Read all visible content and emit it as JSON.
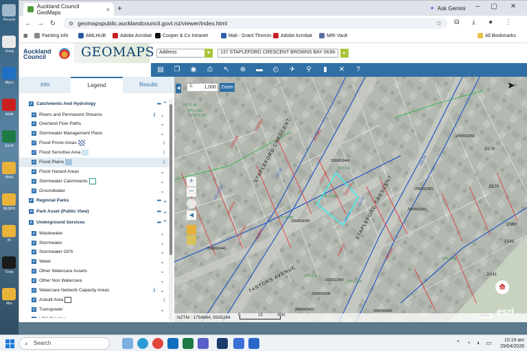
{
  "desktop": {
    "icons": [
      {
        "label": "Recycle",
        "color": "#9fb8cc"
      },
      {
        "label": "Goog",
        "color": "#e8e8e8"
      },
      {
        "label": "Micro",
        "color": "#1f6fc4"
      },
      {
        "label": "Adob",
        "color": "#c82020"
      },
      {
        "label": "Excel",
        "color": "#1d7a43"
      },
      {
        "label": "Work",
        "color": "#e9b23a"
      },
      {
        "label": "RESPO",
        "color": "#e9b23a"
      },
      {
        "label": "BI",
        "color": "#e9b23a"
      },
      {
        "label": "Coop",
        "color": "#1a1a1a"
      },
      {
        "label": "Mrs",
        "color": "#e9b23a"
      }
    ]
  },
  "browser": {
    "tab_title": "Auckland Council GeoMaps",
    "tab_close": "×",
    "new_tab": "+",
    "ask_gemini": "Ask Gemini",
    "url": "geomapspublic.aucklandcouncil.govt.nz/viewer/index.html",
    "bookmarks": [
      {
        "label": "Painting info",
        "color": "#888888"
      },
      {
        "label": "AMLHUB",
        "color": "#2b5aa0"
      },
      {
        "label": "Adobe Acrobat",
        "color": "#c82020"
      },
      {
        "label": "Cooper & Co Intranet",
        "color": "#111111"
      },
      {
        "label": "Mail - Grant Thornin...",
        "color": "#2c5fa8"
      },
      {
        "label": "Adobe Acrobat",
        "color": "#c82020"
      },
      {
        "label": "MRI Vault",
        "color": "#5a6ea0"
      }
    ],
    "all_bookmarks": "All Bookmarks"
  },
  "header": {
    "logo_line1": "Auckland",
    "logo_line2": "Council",
    "app_title": "GEOMAPS",
    "search_type": "Address",
    "search_value": "137 STAPLEFORD CRESCENT BROWNS BAY 0630",
    "clear_icon": "×"
  },
  "panel": {
    "tabs": [
      "Info",
      "Legend",
      "Results"
    ],
    "layers": [
      {
        "label": "Catchments And Hydrology",
        "group": true
      },
      {
        "label": "Rivers and Permanent Streams",
        "info": true
      },
      {
        "label": "Overland Flow Paths"
      },
      {
        "label": "Stormwater Management Plans"
      },
      {
        "label": "Flood Prone Areas",
        "swatch": "hatch"
      },
      {
        "label": "Flood Sensitive Area",
        "swatch": "#cfe6f5"
      },
      {
        "label": "Flood Plains",
        "swatch": "#a6c4e0",
        "highlight": true
      },
      {
        "label": "Flood Hazard Areas"
      },
      {
        "label": "Stormwater Catchments",
        "swatch": "outline-teal"
      },
      {
        "label": "Groundwater"
      },
      {
        "label": "Regional Parks",
        "group": true
      },
      {
        "label": "Park Asset (Public View)",
        "group": true
      },
      {
        "label": "Underground Services",
        "group": true
      },
      {
        "label": "Wastewater"
      },
      {
        "label": "Stormwater"
      },
      {
        "label": "Stormwater GPS"
      },
      {
        "label": "Water"
      },
      {
        "label": "Other Watercare Assets"
      },
      {
        "label": "Other Non Watercare"
      },
      {
        "label": "Watercare Network Capacity Areas",
        "info": true
      },
      {
        "label": "Asbuilt Area",
        "swatch": "outline-dark"
      },
      {
        "label": "Transpower"
      },
      {
        "label": "LPG Pipeline"
      }
    ]
  },
  "map": {
    "scale_prefix": "1:",
    "scale_value": "1,000",
    "zoom_label": "Zoom",
    "coords": "NZTM : 1754884, 5935284",
    "scale_labels": [
      "0",
      "15",
      "30m"
    ],
    "public_label": "public",
    "esri_label": "esri",
    "street_labels": [
      "STAPLEFORD CRESCENT",
      "STAPLEFORD CRESCENT",
      "TARTORS AVENUE"
    ],
    "dti_labels": [
      "DTI 1.49",
      "DTI 1.61",
      "DTI 1.6",
      "DTI 1.05",
      "DTI 1.85",
      "DTI 1.64",
      "DTI 1.06",
      "DTI 1.8",
      "DTI 1.9",
      "DTI 1.74"
    ],
    "asset_ids": [
      "2000663356",
      "2000659440",
      "2000659285",
      "2000112457",
      "2000663441",
      "2000669936",
      "2000663450",
      "2000065585",
      "2000661081",
      "2000661081"
    ],
    "pipe_labels": [
      "150 AC",
      "150 PE",
      "100 AC",
      "150 AC",
      "225 CONC"
    ],
    "red_labels": [
      "1420180",
      "1293090",
      "1522383",
      "1212762",
      "1218830",
      "1257131",
      "1254416",
      "1298210",
      "1410214",
      "1352164"
    ],
    "lot_labels": [
      "2/176",
      "2/170",
      "2/163",
      "2/143",
      "2/141"
    ]
  },
  "taskbar": {
    "search_placeholder": "Search",
    "time": "10:19 am",
    "date": "29/04/2026"
  }
}
